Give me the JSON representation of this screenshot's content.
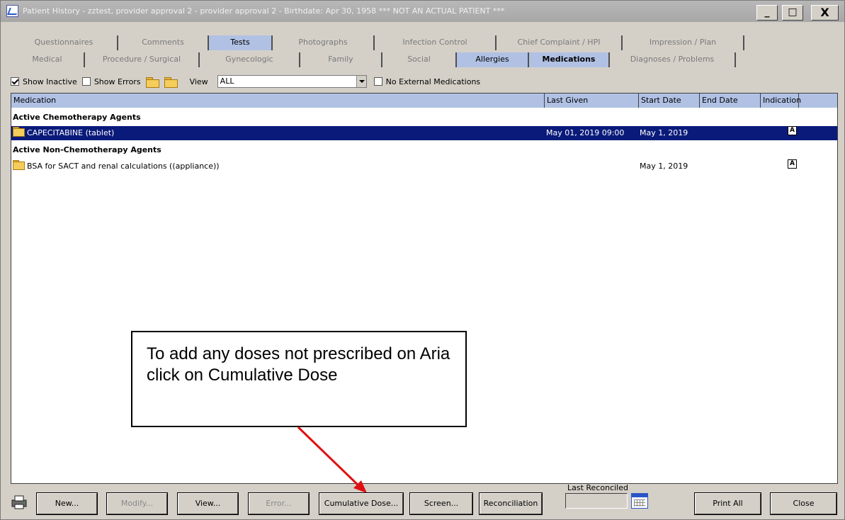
{
  "window": {
    "title": "Patient History - zztest, provider approval 2 - provider approval 2 - Birthdate: Apr 30, 1958 *** NOT AN ACTUAL PATIENT ***",
    "minimize": "_",
    "maximize": "□",
    "close": "X"
  },
  "tabs_row1": [
    {
      "label": "Questionnaires"
    },
    {
      "label": "Comments"
    },
    {
      "label": "Tests"
    },
    {
      "label": "Photographs"
    },
    {
      "label": "Infection Control"
    },
    {
      "label": "Chief Complaint / HPI"
    },
    {
      "label": "Impression / Plan"
    }
  ],
  "tabs_row2": [
    {
      "label": "Medical"
    },
    {
      "label": "Procedure / Surgical"
    },
    {
      "label": "Gynecologic"
    },
    {
      "label": "Family"
    },
    {
      "label": "Social"
    },
    {
      "label": "Allergies"
    },
    {
      "label": "Medications"
    },
    {
      "label": "Diagnoses / Problems"
    }
  ],
  "toolbar": {
    "show_inactive": "Show Inactive",
    "show_inactive_checked": true,
    "show_errors": "Show Errors",
    "show_errors_checked": false,
    "view_label": "View",
    "view_value": "ALL",
    "no_external": "No External Medications",
    "no_external_checked": false
  },
  "grid": {
    "columns": [
      "Medication",
      "Last Given",
      "Start Date",
      "End Date",
      "Indication"
    ],
    "groups": [
      {
        "title": "Active Chemotherapy Agents",
        "rows": [
          {
            "medication": "CAPECITABINE (tablet)",
            "last_given": "May 01, 2019 09:00",
            "start_date": "May 1, 2019",
            "end_date": "",
            "indication": "A",
            "selected": true
          }
        ]
      },
      {
        "title": "Active Non-Chemotherapy Agents",
        "rows": [
          {
            "medication": "BSA for SACT and renal calculations ((appliance))",
            "last_given": "",
            "start_date": "May 1, 2019",
            "end_date": "",
            "indication": "A",
            "selected": false
          }
        ]
      }
    ]
  },
  "callout": {
    "text": "To add any doses not prescribed on Aria click on Cumulative Dose"
  },
  "buttons": {
    "new": "New...",
    "modify": "Modify...",
    "view": "View...",
    "error": "Error...",
    "cumulative_dose": "Cumulative Dose...",
    "screen": "Screen...",
    "reconciliation": "Reconciliation",
    "print_all": "Print All",
    "close": "Close"
  },
  "last_reconciled": {
    "label": "Last Reconciled",
    "value": ""
  },
  "colors": {
    "tab_highlight": "#b0c1e4",
    "selection": "#0a1a7a",
    "arrow": "#e01010"
  }
}
